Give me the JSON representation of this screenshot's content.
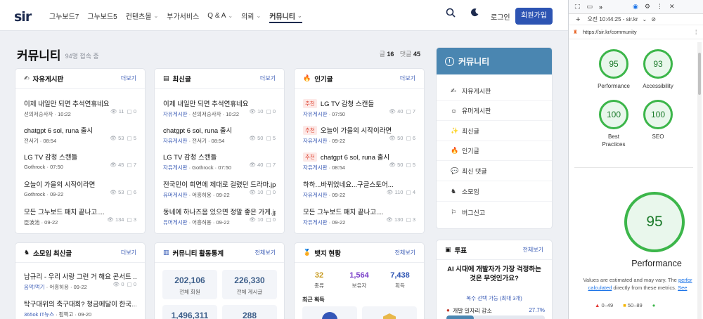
{
  "header": {
    "logo": "sir",
    "nav": [
      {
        "label": "그누보드7",
        "dropdown": false
      },
      {
        "label": "그누보드5",
        "dropdown": false
      },
      {
        "label": "컨텐츠몰",
        "dropdown": true
      },
      {
        "label": "부가서비스",
        "dropdown": false
      },
      {
        "label": "Q & A",
        "dropdown": true
      },
      {
        "label": "의뢰",
        "dropdown": true
      },
      {
        "label": "커뮤니티",
        "dropdown": true,
        "active": true
      }
    ],
    "login": "로그인",
    "signup": "회원가입"
  },
  "page": {
    "title": "커뮤니티",
    "sub": "94명 접속 중",
    "posts_label": "글",
    "posts_count": "16",
    "comments_label": "댓글",
    "comments_count": "45"
  },
  "cards": {
    "free": {
      "title": "자유게시판",
      "more": "더보기",
      "posts": [
        {
          "title": "이제 내일만 되면 추석연휴네요",
          "meta": "선의저승사자 · 10:22",
          "views": "11",
          "comments": "0"
        },
        {
          "title": "chatgpt 6 sol, runa 출시",
          "meta": "전서기 · 08:54",
          "views": "53",
          "comments": "5"
        },
        {
          "title": "LG TV 감청 스캔들",
          "meta": "Gothrock · 07:50",
          "views": "45",
          "comments": "7"
        },
        {
          "title": "오늘이 가을의 시작이라면",
          "meta": "Gothrock · 09-22",
          "views": "53",
          "comments": "6"
        },
        {
          "title": "모든 그누보드 패치 끝나고....",
          "meta": "臣波池 · 09-22",
          "views": "134",
          "comments": "3"
        }
      ]
    },
    "latest": {
      "title": "최신글",
      "more": "더보기",
      "posts": [
        {
          "title": "이제 내일만 되면 추석연휴네요",
          "board": "자유게시판",
          "meta": "선의저승사자 · 10:22",
          "views": "10",
          "comments": "0"
        },
        {
          "title": "chatgpt 6 sol, runa 출시",
          "board": "자유게시판",
          "meta": "전서기 · 08:54",
          "views": "50",
          "comments": "5"
        },
        {
          "title": "LG TV 감청 스캔들",
          "board": "자유게시판",
          "meta": "Gothrock · 07:50",
          "views": "40",
          "comments": "7"
        },
        {
          "title": "전국민이 희면에 제대로 걸렸던 드라마.jpg",
          "board": "유머게시판",
          "meta": "어흥허용 · 09-22",
          "views": "10",
          "comments": "0"
        },
        {
          "title": "동네에 하나즈음 있으면 정말 좋은 가게.jpg",
          "board": "유머게시판",
          "meta": "어흥허용 · 09-22",
          "views": "10",
          "comments": "0"
        }
      ]
    },
    "popular": {
      "title": "인기글",
      "more": "더보기",
      "posts": [
        {
          "tag": "추천",
          "title": "LG TV 감청 스캔들",
          "board": "자유게시판",
          "meta": "07:50",
          "views": "40",
          "comments": "7"
        },
        {
          "tag": "추천",
          "title": "오늘이 가을의 시작이라면",
          "board": "자유게시판",
          "meta": "09-22",
          "views": "50",
          "comments": "6"
        },
        {
          "tag": "추천",
          "title": "chatgpt 6 sol, runa 출시",
          "board": "자유게시판",
          "meta": "08:54",
          "views": "50",
          "comments": "5"
        },
        {
          "tag": "",
          "title": "하하...바뀌었네요...구글스토어...",
          "board": "자유게시판",
          "meta": "09-22",
          "views": "110",
          "comments": "4"
        },
        {
          "tag": "",
          "title": "모든 그누보드 패치 끝나고....",
          "board": "자유게시판",
          "meta": "09-22",
          "views": "130",
          "comments": "3"
        }
      ]
    },
    "group": {
      "title": "소모임 최신글",
      "more": "더보기",
      "posts": [
        {
          "title": "남규리 - 우리 사랑 그런 거 해요 콘서트 ...",
          "board": "음악/먹기",
          "meta": "어흥허용 · 09-22",
          "views": "0",
          "comments": "0"
        },
        {
          "title": "탁구대위의 축구대회? 청금메달이 한국...",
          "board": "365ok IT뉴스",
          "meta": "펌핵고 · 09-20",
          "views": "",
          "comments": ""
        }
      ]
    },
    "stats": {
      "title": "커뮤니티 활동통계",
      "more": "전체보기",
      "items": [
        {
          "value": "202,106",
          "label": "전체 회원"
        },
        {
          "value": "226,330",
          "label": "전체 게시글"
        },
        {
          "value": "1,496,311",
          "label": ""
        },
        {
          "value": "288",
          "label": ""
        }
      ]
    },
    "badges": {
      "title": "뱃지 현황",
      "more": "전체보기",
      "items": [
        {
          "value": "32",
          "label": "종류",
          "color": "#c79a1e"
        },
        {
          "value": "1,564",
          "label": "보유자",
          "color": "#7a3fc9"
        },
        {
          "value": "7,438",
          "label": "획득",
          "color": "#2d54b3"
        }
      ],
      "recent": "최근 획득"
    }
  },
  "sidebar": {
    "title": "커뮤니티",
    "items": [
      {
        "icon": "✍",
        "label": "자유게시판"
      },
      {
        "icon": "☺",
        "label": "유머게시판"
      },
      {
        "icon": "✨",
        "label": "최신글"
      },
      {
        "icon": "🔥",
        "label": "인기글"
      },
      {
        "icon": "💬",
        "label": "최신 댓글"
      },
      {
        "icon": "♞",
        "label": "소모임"
      },
      {
        "icon": "⚐",
        "label": "버그신고"
      }
    ]
  },
  "vote": {
    "title": "투표",
    "more": "전체보기",
    "question": "AI 시대에 개발자가 가장 걱정하는 것은 무엇인가요?",
    "note": "복수 선택 가능 (최대 3개)",
    "option": "개발 일자리 감소",
    "option_pct": "27.7%",
    "option_fill": 0.277
  },
  "devtools": {
    "time": "오전 10:44:25 - sir.kr",
    "url": "https://sir.kr/community",
    "scores": [
      {
        "value": "95",
        "label": "Performance"
      },
      {
        "value": "93",
        "label": "Accessibility"
      },
      {
        "value": "100",
        "label": "Best Practices"
      },
      {
        "value": "100",
        "label": "SEO"
      }
    ],
    "big_score": "95",
    "big_label": "Performance",
    "note_pre": "Values are estimated and may vary. The ",
    "note_link1": "perfor",
    "note_link2": "calculated",
    "note_mid": " directly from these metrics. ",
    "note_link3": "See",
    "legend": [
      "0–49",
      "50–89"
    ]
  },
  "colors": {
    "brand": "#1d2b4f",
    "accent": "#2d54b3",
    "sidebar_head": "#4a86b1",
    "pass": "#3cb64a"
  }
}
